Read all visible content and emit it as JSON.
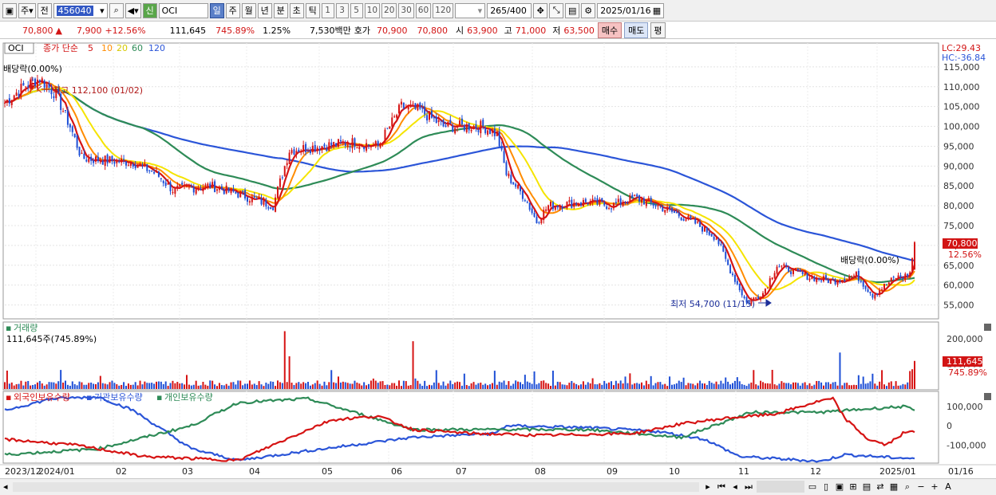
{
  "toolbar": {
    "market": "주",
    "kind": "전",
    "code": "456040",
    "sector_tag": "신",
    "name": "OCI",
    "periods": [
      "일",
      "주",
      "월",
      "년",
      "분",
      "초",
      "틱"
    ],
    "active_period": "일",
    "intervals": [
      "1",
      "3",
      "5",
      "10",
      "20",
      "30",
      "60",
      "120"
    ],
    "count": "265/400",
    "date": "2025/01/16"
  },
  "quote": {
    "price": "70,800",
    "change": "7,900",
    "change_pct": "+12.56%",
    "volume": "111,645",
    "volume_ratio": "745.89%",
    "turnover_pct": "1.25%",
    "trade_value": "7,530백만",
    "hoga_label": "호가",
    "bid": "70,900",
    "ask": "70,800",
    "open_label": "시",
    "open": "63,900",
    "high_label": "고",
    "high": "71,000",
    "low_label": "저",
    "low": "63,500",
    "buy_label": "매수",
    "sell_label": "매도",
    "mode_label": "평"
  },
  "chart_data": {
    "type": "candlestick",
    "ticker": "OCI",
    "legend": {
      "label": "종가 단순",
      "periods": [
        "5",
        "10",
        "20",
        "60",
        "120"
      ]
    },
    "lc": "LC:29.43",
    "hc": "HC:-36.84",
    "y_ticks": [
      "115,000",
      "110,000",
      "105,000",
      "100,000",
      "95,000",
      "90,000",
      "85,000",
      "80,000",
      "75,000",
      "70,000",
      "65,000",
      "60,000",
      "55,000"
    ],
    "ylim": [
      51500,
      121000
    ],
    "x_labels": [
      "2023/12",
      "2024/01",
      "02",
      "03",
      "04",
      "05",
      "06",
      "07",
      "08",
      "09",
      "10",
      "11",
      "12",
      "2025/01",
      "01/16"
    ],
    "current_price_tag": "70,800",
    "current_pct_tag": "12.56%",
    "annotations": {
      "dividend1": "배당락(0.00%)",
      "high": "최고 112,100 (01/02)",
      "dividend2": "배당락(0.00%)",
      "low": "최저 54,700 (11/15)"
    },
    "close_anchors": [
      [
        0,
        106000
      ],
      [
        8,
        110000
      ],
      [
        15,
        112100
      ],
      [
        22,
        108000
      ],
      [
        28,
        100000
      ],
      [
        33,
        92000
      ],
      [
        42,
        91500
      ],
      [
        55,
        91000
      ],
      [
        65,
        88000
      ],
      [
        72,
        84000
      ],
      [
        88,
        85000
      ],
      [
        100,
        83000
      ],
      [
        115,
        80000
      ],
      [
        122,
        94000
      ],
      [
        135,
        95000
      ],
      [
        150,
        96000
      ],
      [
        160,
        95000
      ],
      [
        170,
        105000
      ],
      [
        178,
        104000
      ],
      [
        188,
        100000
      ],
      [
        205,
        100000
      ],
      [
        211,
        98000
      ],
      [
        215,
        88000
      ],
      [
        223,
        82000
      ],
      [
        228,
        76000
      ],
      [
        233,
        80000
      ],
      [
        250,
        81000
      ],
      [
        260,
        80000
      ],
      [
        270,
        82000
      ],
      [
        280,
        80000
      ],
      [
        295,
        76000
      ],
      [
        305,
        72000
      ],
      [
        310,
        65000
      ],
      [
        318,
        55500
      ],
      [
        325,
        58000
      ],
      [
        331,
        65000
      ],
      [
        345,
        62000
      ],
      [
        355,
        61000
      ],
      [
        365,
        62500
      ],
      [
        372,
        57500
      ],
      [
        382,
        62000
      ],
      [
        385,
        62000
      ],
      [
        388,
        63000
      ],
      [
        390,
        70800
      ]
    ],
    "volume": {
      "title": "거래량",
      "value_label": "111,645주(745.89%)",
      "y_ticks": [
        "200,000",
        "100,000"
      ],
      "ymax": 260000,
      "current_tag": "111,645",
      "current_pct_tag": "745.89%"
    },
    "holdings": {
      "series_names": [
        "외국인보유수량",
        "기관보유수량",
        "개인보유수량"
      ],
      "series_colors": [
        "#d61414",
        "#2b55d8",
        "#2e8b57"
      ],
      "y_ticks": [
        "100,000",
        "0",
        "-100,000"
      ],
      "ylim": [
        -190000,
        170000
      ],
      "foreign": [
        [
          0,
          -70000
        ],
        [
          30,
          -100000
        ],
        [
          60,
          -160000
        ],
        [
          100,
          -180000
        ],
        [
          130,
          -20000
        ],
        [
          140,
          30000
        ],
        [
          160,
          50000
        ],
        [
          175,
          -20000
        ],
        [
          200,
          -40000
        ],
        [
          230,
          -50000
        ],
        [
          270,
          -40000
        ],
        [
          290,
          10000
        ],
        [
          310,
          40000
        ],
        [
          330,
          60000
        ],
        [
          350,
          130000
        ],
        [
          355,
          140000
        ],
        [
          360,
          40000
        ],
        [
          370,
          -70000
        ],
        [
          378,
          -100000
        ],
        [
          385,
          -40000
        ],
        [
          390,
          -30000
        ]
      ],
      "institution": [
        [
          0,
          80000
        ],
        [
          20,
          140000
        ],
        [
          40,
          150000
        ],
        [
          55,
          80000
        ],
        [
          80,
          -120000
        ],
        [
          100,
          -180000
        ],
        [
          130,
          -130000
        ],
        [
          175,
          -60000
        ],
        [
          210,
          -40000
        ],
        [
          215,
          0
        ],
        [
          250,
          -10000
        ],
        [
          280,
          -30000
        ],
        [
          300,
          -70000
        ],
        [
          315,
          -160000
        ],
        [
          350,
          -185000
        ],
        [
          360,
          -150000
        ],
        [
          380,
          -165000
        ],
        [
          390,
          -170000
        ]
      ],
      "individual": [
        [
          0,
          -150000
        ],
        [
          40,
          -120000
        ],
        [
          80,
          0
        ],
        [
          100,
          120000
        ],
        [
          130,
          140000
        ],
        [
          175,
          -20000
        ],
        [
          215,
          -20000
        ],
        [
          250,
          -20000
        ],
        [
          290,
          -60000
        ],
        [
          320,
          70000
        ],
        [
          350,
          70000
        ],
        [
          385,
          100000
        ],
        [
          390,
          80000
        ]
      ]
    }
  }
}
